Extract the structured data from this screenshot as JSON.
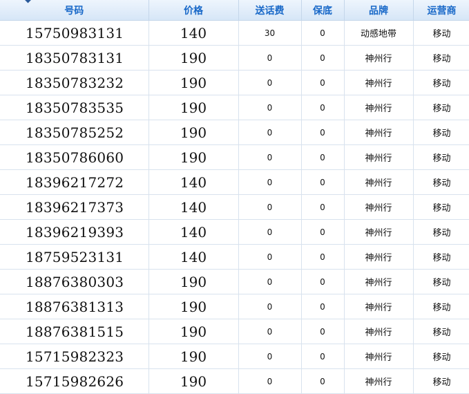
{
  "headers": {
    "number": "号码",
    "price": "价格",
    "credit": "送话费",
    "min_spend": "保底",
    "brand": "品牌",
    "carrier": "运营商"
  },
  "rows": [
    {
      "number": "15750983131",
      "price": "140",
      "credit": "30",
      "min_spend": "0",
      "brand": "动感地带",
      "carrier": "移动"
    },
    {
      "number": "18350783131",
      "price": "190",
      "credit": "0",
      "min_spend": "0",
      "brand": "神州行",
      "carrier": "移动"
    },
    {
      "number": "18350783232",
      "price": "190",
      "credit": "0",
      "min_spend": "0",
      "brand": "神州行",
      "carrier": "移动"
    },
    {
      "number": "18350783535",
      "price": "190",
      "credit": "0",
      "min_spend": "0",
      "brand": "神州行",
      "carrier": "移动"
    },
    {
      "number": "18350785252",
      "price": "190",
      "credit": "0",
      "min_spend": "0",
      "brand": "神州行",
      "carrier": "移动"
    },
    {
      "number": "18350786060",
      "price": "190",
      "credit": "0",
      "min_spend": "0",
      "brand": "神州行",
      "carrier": "移动"
    },
    {
      "number": "18396217272",
      "price": "140",
      "credit": "0",
      "min_spend": "0",
      "brand": "神州行",
      "carrier": "移动"
    },
    {
      "number": "18396217373",
      "price": "140",
      "credit": "0",
      "min_spend": "0",
      "brand": "神州行",
      "carrier": "移动"
    },
    {
      "number": "18396219393",
      "price": "140",
      "credit": "0",
      "min_spend": "0",
      "brand": "神州行",
      "carrier": "移动"
    },
    {
      "number": "18759523131",
      "price": "140",
      "credit": "0",
      "min_spend": "0",
      "brand": "神州行",
      "carrier": "移动"
    },
    {
      "number": "18876380303",
      "price": "190",
      "credit": "0",
      "min_spend": "0",
      "brand": "神州行",
      "carrier": "移动"
    },
    {
      "number": "18876381313",
      "price": "190",
      "credit": "0",
      "min_spend": "0",
      "brand": "神州行",
      "carrier": "移动"
    },
    {
      "number": "18876381515",
      "price": "190",
      "credit": "0",
      "min_spend": "0",
      "brand": "神州行",
      "carrier": "移动"
    },
    {
      "number": "15715982323",
      "price": "190",
      "credit": "0",
      "min_spend": "0",
      "brand": "神州行",
      "carrier": "移动"
    },
    {
      "number": "15715982626",
      "price": "190",
      "credit": "0",
      "min_spend": "0",
      "brand": "神州行",
      "carrier": "移动"
    }
  ]
}
